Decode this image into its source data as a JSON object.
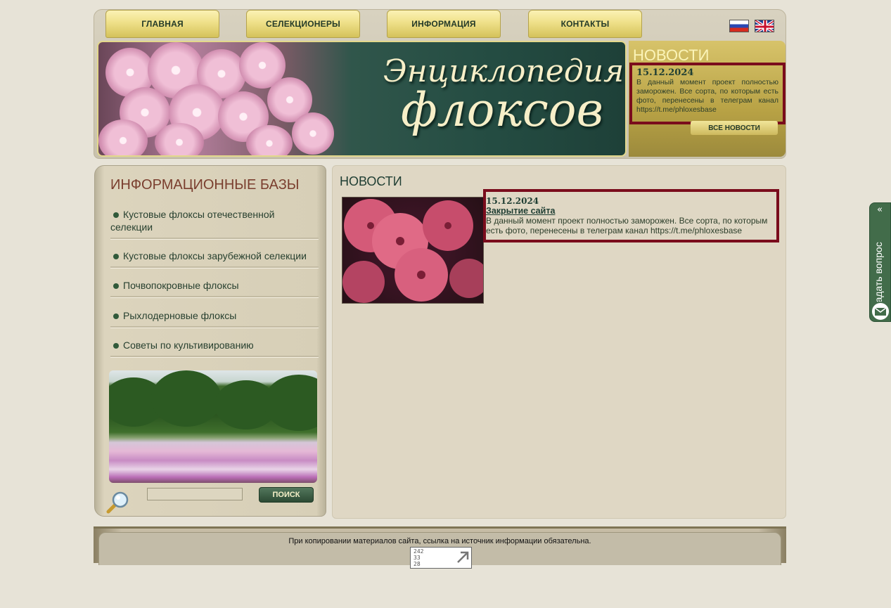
{
  "nav": {
    "items": [
      {
        "label": "ГЛАВНАЯ"
      },
      {
        "label": "СЕЛЕКЦИОНЕРЫ"
      },
      {
        "label": "ИНФОРМАЦИЯ"
      },
      {
        "label": "КОНТАКТЫ"
      }
    ]
  },
  "banner": {
    "title_line1": "Энциклопедия",
    "title_line2": "флоксов"
  },
  "news_widget": {
    "title": "НОВОСТИ",
    "date": "15.12.2024",
    "text": "В данный момент проект полностью заморожен. Все сорта, по которым есть фото, перенесены в телеграм канал https://t.me/phloxesbase",
    "all_news_label": "ВСЕ НОВОСТИ"
  },
  "sidebar": {
    "title": "ИНФОРМАЦИОННЫЕ БАЗЫ",
    "items": [
      {
        "label": "Кустовые флоксы отечественной селекции"
      },
      {
        "label": "Кустовые флоксы зарубежной селекции"
      },
      {
        "label": "Почвопокровные флоксы"
      },
      {
        "label": "Рыхлодерновые флоксы"
      },
      {
        "label": "Советы по культивированию"
      }
    ],
    "search": {
      "value": "",
      "button_label": "ПОИСК"
    }
  },
  "main": {
    "title": "НОВОСТИ",
    "news": {
      "date": "15.12.2024",
      "headline": "Закрытие сайта",
      "text": "В данный момент проект полностью заморожен. Все сорта, по которым есть фото, перенесены в телеграм канал https://t.me/phloxesbase"
    }
  },
  "footer": {
    "note": "При копировании материалов сайта, ссылка на источник информации обязательна.",
    "counter": [
      "242",
      "33",
      "28"
    ]
  },
  "ask_tab": {
    "label": "Задать вопрос",
    "arrows": "«"
  },
  "colors": {
    "highlight_frame": "#7a0c1c",
    "dark_green": "#1f3e33",
    "gold": "#efe089"
  },
  "icons": [
    "flag-ru-icon",
    "flag-en-icon",
    "search-icon",
    "mail-icon",
    "double-chevron-left-icon"
  ]
}
